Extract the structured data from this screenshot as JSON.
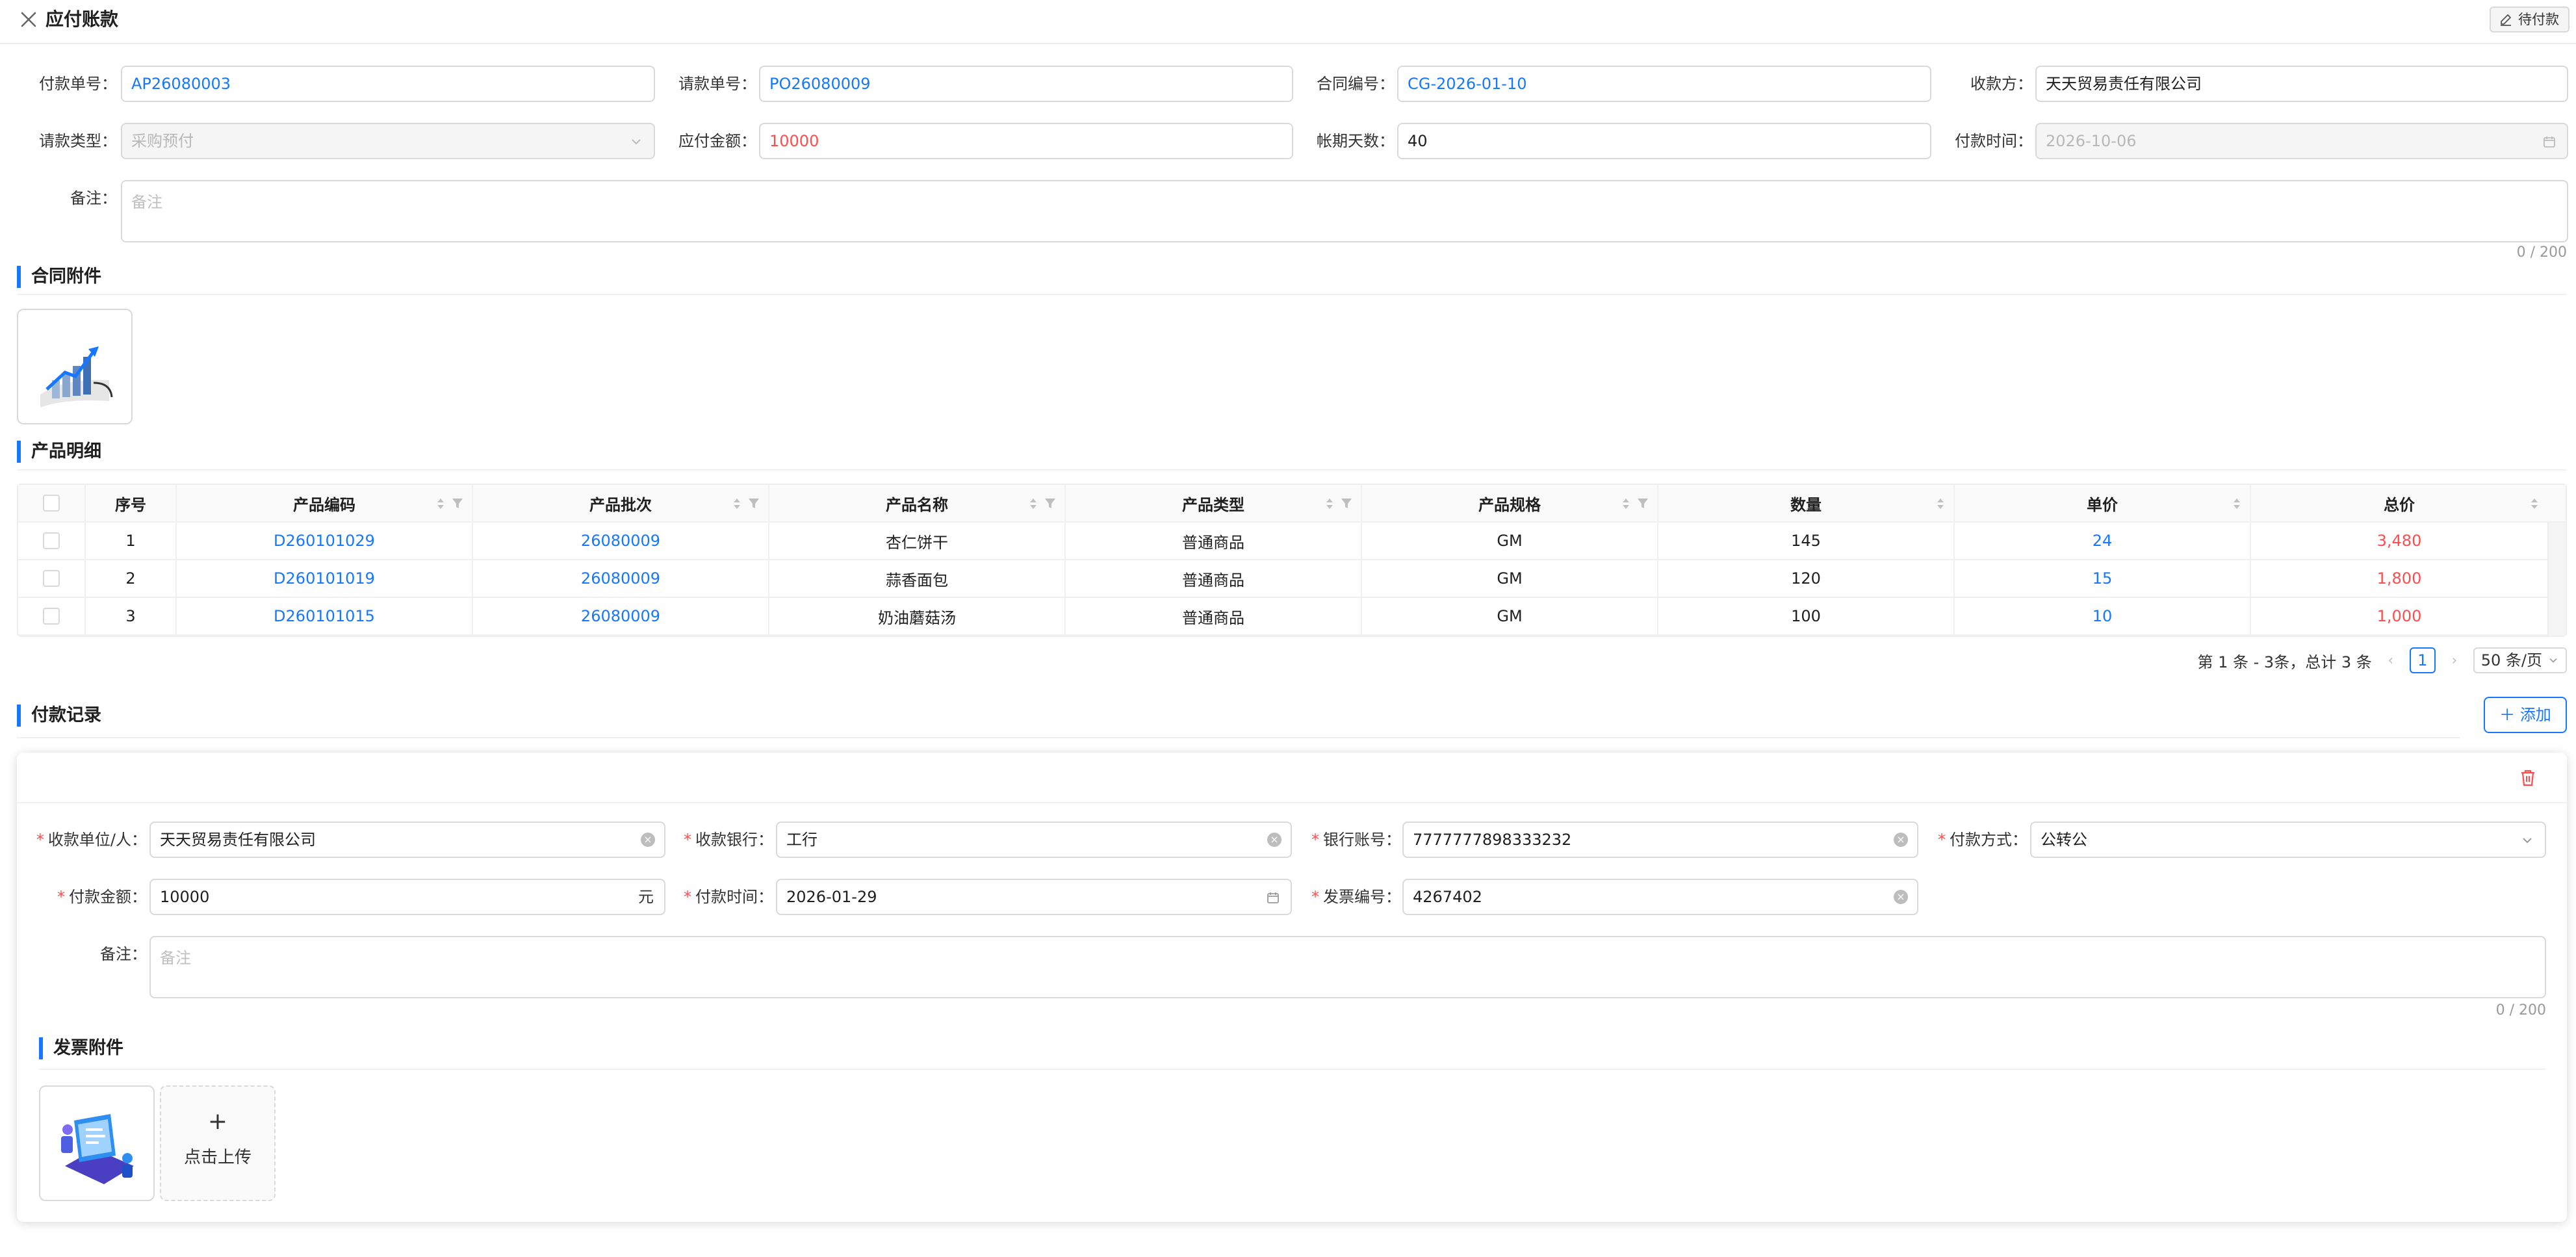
{
  "header": {
    "title": "应付账款",
    "status_button": "待付款"
  },
  "form": {
    "payment_no": {
      "label": "付款单号",
      "value": "AP26080003"
    },
    "request_no": {
      "label": "请款单号",
      "value": "PO26080009"
    },
    "contract_no": {
      "label": "合同编号",
      "value": "CG-2026-01-10"
    },
    "payee": {
      "label": "收款方",
      "value": "天天贸易责任有限公司"
    },
    "request_type": {
      "label": "请款类型",
      "value": "采购预付"
    },
    "amount_due": {
      "label": "应付金额",
      "value": "10000"
    },
    "term_days": {
      "label": "帐期天数",
      "value": "40"
    },
    "payment_time": {
      "label": "付款时间",
      "value": "2026-10-06"
    },
    "remark": {
      "label": "备注",
      "placeholder": "备注",
      "counter": "0 / 200"
    }
  },
  "sections": {
    "contract_attachments": "合同附件",
    "product_details": "产品明细",
    "payment_records": "付款记录",
    "invoice_attachments": "发票附件"
  },
  "table": {
    "headers": [
      "序号",
      "产品编码",
      "产品批次",
      "产品名称",
      "产品类型",
      "产品规格",
      "数量",
      "单价",
      "总价"
    ],
    "rows": [
      {
        "index": "1",
        "code": "D260101029",
        "batch": "26080009",
        "name": "杏仁饼干",
        "type": "普通商品",
        "spec": "GM",
        "qty": "145",
        "price": "24",
        "total": "3,480"
      },
      {
        "index": "2",
        "code": "D260101019",
        "batch": "26080009",
        "name": "蒜香面包",
        "type": "普通商品",
        "spec": "GM",
        "qty": "120",
        "price": "15",
        "total": "1,800"
      },
      {
        "index": "3",
        "code": "D260101015",
        "batch": "26080009",
        "name": "奶油蘑菇汤",
        "type": "普通商品",
        "spec": "GM",
        "qty": "100",
        "price": "10",
        "total": "1,000"
      }
    ]
  },
  "pagination": {
    "summary": "第 1 条 - 3条，总计 3 条",
    "current": "1",
    "page_size": "50 条/页"
  },
  "payment_record": {
    "add_label": "添加",
    "receiver": {
      "label": "收款单位/人",
      "value": "天天贸易责任有限公司"
    },
    "bank": {
      "label": "收款银行",
      "value": "工行"
    },
    "account": {
      "label": "银行账号",
      "value": "7777777898333232"
    },
    "method": {
      "label": "付款方式",
      "value": "公转公"
    },
    "amount": {
      "label": "付款金额",
      "value": "10000",
      "unit": "元"
    },
    "time": {
      "label": "付款时间",
      "value": "2026-01-29"
    },
    "invoice_no": {
      "label": "发票编号",
      "value": "4267402"
    },
    "remark": {
      "label": "备注",
      "placeholder": "备注",
      "counter": "0 / 200"
    },
    "upload_label": "点击上传"
  },
  "colors": {
    "primary": "#1677ff",
    "danger": "#ff4d4f",
    "border": "#d9d9d9"
  }
}
